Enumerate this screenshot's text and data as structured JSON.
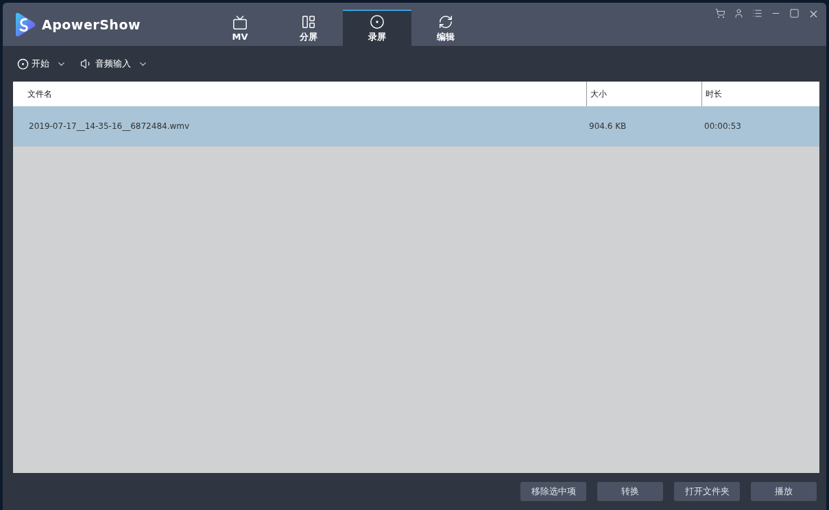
{
  "app": {
    "name": "ApowerShow"
  },
  "tabs": [
    {
      "kind": "tv",
      "label": "MV",
      "selected": false
    },
    {
      "kind": "layout",
      "label": "分屏",
      "selected": false
    },
    {
      "kind": "record",
      "label": "录屏",
      "selected": true
    },
    {
      "kind": "refresh",
      "label": "编辑",
      "selected": false
    }
  ],
  "toolbar": [
    {
      "kind": "record",
      "label": "开始"
    },
    {
      "kind": "speaker",
      "label": "音频输入"
    }
  ],
  "table": {
    "columns": [
      "文件名",
      "大小",
      "时长"
    ],
    "rows": [
      {
        "cells": [
          "2019-07-17__14-35-16__6872484.wmv",
          "904.6 KB",
          "00:00:53"
        ],
        "selected": true
      }
    ]
  },
  "buttons": [
    "移除选中项",
    "转换",
    "打开文件夹",
    "播放"
  ]
}
